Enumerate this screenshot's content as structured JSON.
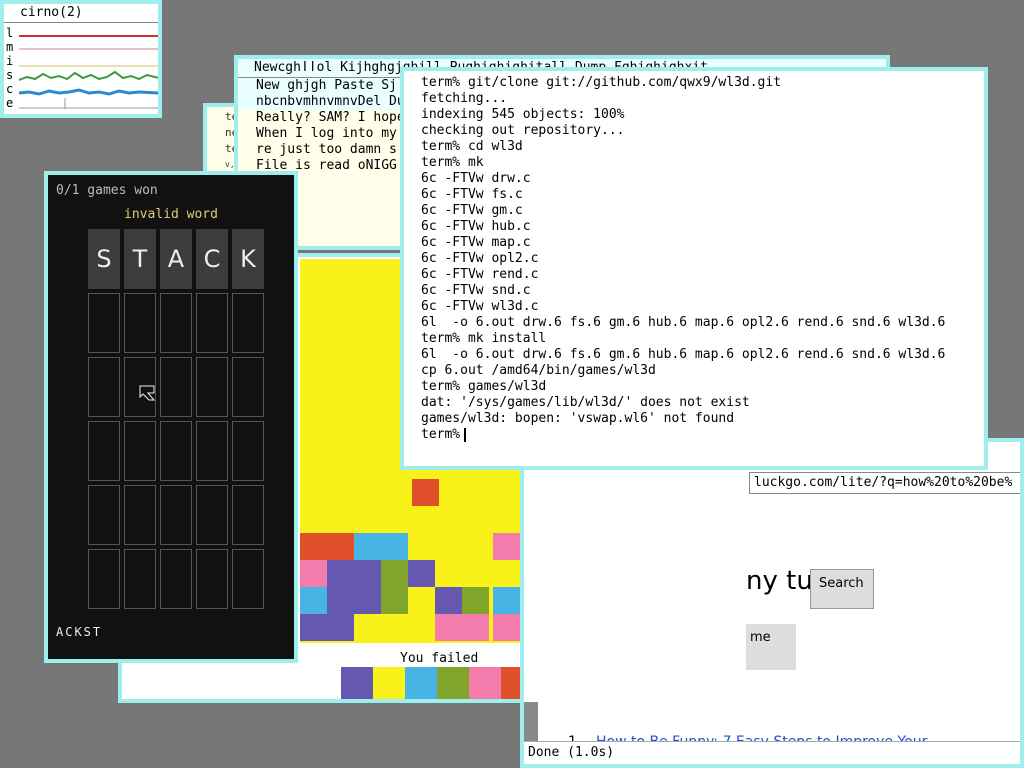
{
  "stats": {
    "title": "cirno(2)",
    "labels": [
      "l",
      "m",
      "i",
      "s",
      "c",
      "e"
    ]
  },
  "acme": {
    "tag": "Newcghǀǀol Kijhghgjghill Pughighighitall Dump Fghighighxit",
    "lines": [
      "New ghjgh Paste Sj",
      "nbcnbvmhnvmnvDel Du",
      "Really? SAM? I hope",
      "When I log into my",
      "re just too damn s",
      "File is read oNIGG"
    ]
  },
  "mini": {
    "lines": [
      "te",
      "ne",
      "te",
      "v,f"
    ]
  },
  "wordle": {
    "games_won": "0/1 games won",
    "message": "invalid word",
    "guess": [
      "S",
      "T",
      "A",
      "C",
      "K"
    ],
    "keys": "ACKST"
  },
  "game": {
    "status": "You failed",
    "palette": [
      "#6657b0",
      "#f9f21a",
      "#48b4e6",
      "#7fa52b",
      "#f47cac",
      "#e0502a"
    ]
  },
  "browser": {
    "url": "luckgo.com/lite/?q=how%20to%20be%",
    "query_fragment": "ny tu",
    "search_label": "Search",
    "other_button": "me",
    "result_number": "1.",
    "result_title": "How to Be Funny: 7 Easy Steps to Improve Your",
    "status": "Done (1.0s)"
  },
  "terminal": {
    "lines": [
      "term% git/clone git://github.com/qwx9/wl3d.git",
      "fetching...",
      "indexing 545 objects: 100%",
      "checking out repository...",
      "term% cd wl3d",
      "term% mk",
      "6c -FTVw drw.c",
      "6c -FTVw fs.c",
      "6c -FTVw gm.c",
      "6c -FTVw hub.c",
      "6c -FTVw map.c",
      "6c -FTVw opl2.c",
      "6c -FTVw rend.c",
      "6c -FTVw snd.c",
      "6c -FTVw wl3d.c",
      "6l  -o 6.out drw.6 fs.6 gm.6 hub.6 map.6 opl2.6 rend.6 snd.6 wl3d.6",
      "term% mk install",
      "6l  -o 6.out drw.6 fs.6 gm.6 hub.6 map.6 opl2.6 rend.6 snd.6 wl3d.6",
      "cp 6.out /amd64/bin/games/wl3d",
      "term% games/wl3d",
      "dat: '/sys/games/lib/wl3d/' does not exist",
      "games/wl3d: bopen: 'vswap.wl6' not found"
    ],
    "prompt": "term%"
  }
}
